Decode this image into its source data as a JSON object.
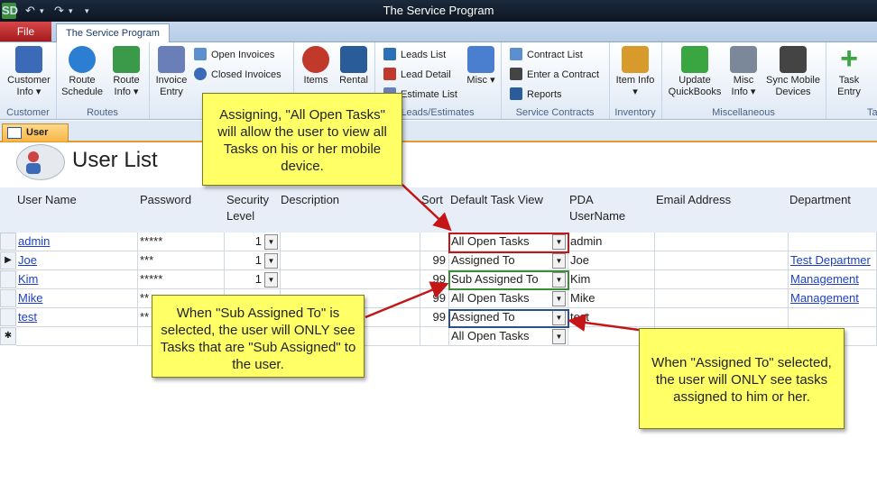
{
  "window": {
    "title": "The Service Program",
    "app_icon_label": "SD"
  },
  "tabs": {
    "file": "File",
    "program": "The Service Program"
  },
  "ribbon": {
    "groups": [
      {
        "label": "Customer",
        "buttons": [
          {
            "label": "Customer Info ▾",
            "icon": "customer-icon",
            "color": "#3b6ab8"
          }
        ]
      },
      {
        "label": "Routes",
        "buttons": [
          {
            "label": "Route Schedule",
            "icon": "globe-icon",
            "color": "#2b7ed1"
          },
          {
            "label": "Route Info ▾",
            "icon": "map-icon",
            "color": "#3a9a4a"
          }
        ]
      },
      {
        "label": "",
        "buttons": [
          {
            "label": "Invoice Entry",
            "icon": "invoice-icon",
            "color": "#6a7fb8"
          }
        ],
        "small": [
          {
            "label": "Open Invoices",
            "icon": "open-invoices-icon"
          },
          {
            "label": "Closed Invoices",
            "icon": "closed-invoices-icon"
          }
        ]
      },
      {
        "label": "",
        "buttons": [
          {
            "label": "Items",
            "icon": "items-icon",
            "color": "#c0392b"
          },
          {
            "label": "Rental",
            "icon": "rental-icon",
            "color": "#2a5c9a"
          }
        ]
      },
      {
        "label": "Leads/Estimates",
        "small": [
          {
            "label": "Leads List",
            "icon": "leads-list-icon"
          },
          {
            "label": "Lead Detail",
            "icon": "lead-detail-icon"
          },
          {
            "label": "Estimate List",
            "icon": "estimate-list-icon"
          }
        ],
        "buttons": [
          {
            "label": "Misc ▾",
            "icon": "misc-icon",
            "color": "#4a7fd0"
          }
        ]
      },
      {
        "label": "Service Contracts",
        "small": [
          {
            "label": "Contract List",
            "icon": "contract-list-icon"
          },
          {
            "label": "Enter a Contract",
            "icon": "enter-contract-icon"
          },
          {
            "label": "Reports",
            "icon": "reports-icon"
          }
        ]
      },
      {
        "label": "Inventory",
        "buttons": [
          {
            "label": "Item Info ▾",
            "icon": "item-info-icon",
            "color": "#d89a2a"
          }
        ]
      },
      {
        "label": "Miscellaneous",
        "buttons": [
          {
            "label": "Update QuickBooks",
            "icon": "quickbooks-icon",
            "color": "#3aa641"
          },
          {
            "label": "Misc Info ▾",
            "icon": "tools-icon",
            "color": "#7a8899"
          },
          {
            "label": "Sync Mobile Devices",
            "icon": "sync-icon",
            "color": "#444444"
          }
        ]
      },
      {
        "label": "Ta",
        "buttons": [
          {
            "label": "Task Entry",
            "icon": "plus-icon",
            "color": "#3aa641"
          }
        ]
      }
    ]
  },
  "doc_tab": "User List",
  "page_title": "User List",
  "columns": {
    "user_name": "User Name",
    "password": "Password",
    "security_level": [
      "Security",
      "Level"
    ],
    "description": "Description",
    "sort": "Sort",
    "default_task_view": "Default Task View",
    "pda_username": [
      "PDA",
      "UserName"
    ],
    "email": "Email Address",
    "department": "Department"
  },
  "rows": [
    {
      "user": "admin",
      "password": "*****",
      "level": "1",
      "sort": "",
      "view": "All Open Tasks",
      "pda": "admin",
      "dept": "",
      "marker": ""
    },
    {
      "user": "Joe",
      "password": "***",
      "level": "1",
      "sort": "99",
      "view": "Assigned To",
      "pda": "Joe",
      "dept": "Test Departmer",
      "marker": "▶"
    },
    {
      "user": "Kim",
      "password": "*****",
      "level": "1",
      "sort": "99",
      "view": "Sub Assigned To",
      "pda": "Kim",
      "dept": "Management",
      "marker": ""
    },
    {
      "user": "Mike",
      "password": "**",
      "level": "",
      "sort": "99",
      "view": "All Open Tasks",
      "pda": "Mike",
      "dept": "Management",
      "marker": ""
    },
    {
      "user": "test",
      "password": "**",
      "level": "",
      "sort": "99",
      "view": "Assigned To",
      "pda": "test",
      "dept": "",
      "marker": ""
    }
  ],
  "new_row": {
    "marker": "✱",
    "view": "All Open Tasks"
  },
  "callouts": {
    "all_open": "Assigning, \"All Open Tasks\" will allow the user to view all Tasks on his or her mobile device.",
    "sub_assigned": "When \"Sub Assigned To\" is selected, the user will ONLY see Tasks that are \"Sub Assigned\" to the user.",
    "assigned": "When \"Assigned To\" selected, the user will ONLY see tasks assigned to him or her."
  },
  "colors": {
    "highlight_red": "#c41616",
    "highlight_green": "#3b8f3b",
    "highlight_blue": "#2a4f8f",
    "callout_yellow": "#ffff66"
  }
}
